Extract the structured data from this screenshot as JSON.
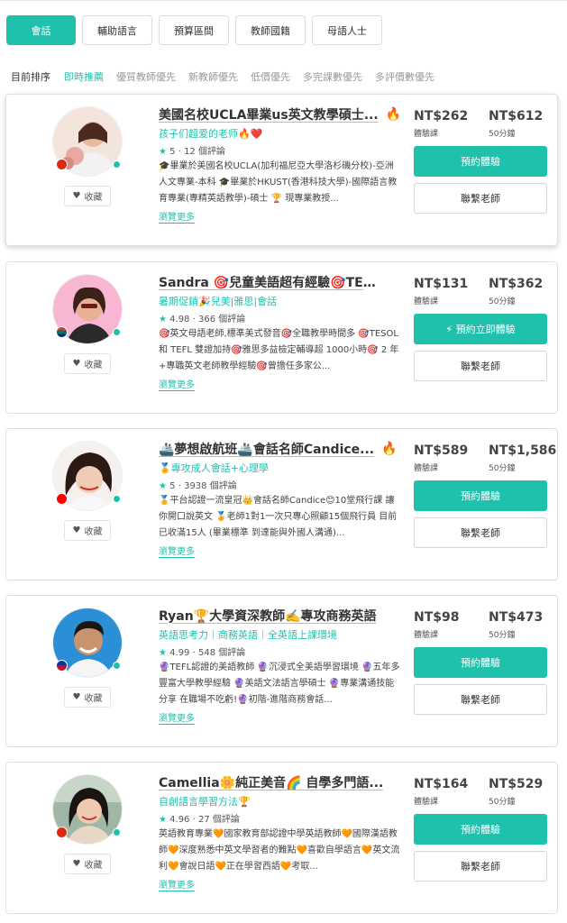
{
  "filters": [
    {
      "label": "會話",
      "active": true
    },
    {
      "label": "輔助語言",
      "active": false
    },
    {
      "label": "預算區間",
      "active": false
    },
    {
      "label": "教師國籍",
      "active": false
    },
    {
      "label": "母語人士",
      "active": false
    }
  ],
  "sort": {
    "label": "目前排序",
    "options": [
      "即時推薦",
      "優質教師優先",
      "新教師優先",
      "低價優先",
      "多完課數優先",
      "多評價數優先"
    ],
    "active_index": 0
  },
  "common": {
    "fav_label": "收藏",
    "trial_unit": "體驗課",
    "regular_unit": "50分鐘",
    "contact_label": "聯繫老師",
    "more_label": "瀏覽更多",
    "star": "★"
  },
  "teachers": [
    {
      "name": "美國名校UCLA畢業us英文教學碩士...",
      "hot": true,
      "tag": "孩子们超爱的老师🔥❤️",
      "rating": "5",
      "reviews": "12 個評論",
      "desc": "🎓畢業於美國名校UCLA(加利福尼亞大學洛杉磯分校)-亞洲人文專業-本科 🎓畢業於HKUST(香港科技大學)-國際語言教育專業(專精英語教學)-碩士 🏆 現專業教授...",
      "trial_price": "NT$262",
      "regular_price": "NT$612",
      "trial_button": "預約體驗",
      "flag": "china"
    },
    {
      "name": "Sandra 🎯兒童美語超有經驗🎯TES...",
      "hot": false,
      "tag": "暑期促銷🎉兒美|雅思|會話",
      "rating": "4.98",
      "reviews": "366 個評論",
      "desc": "🎯英文母語老師,標準美式發音🎯全職教學時間多 🎯TESOL 和 TEFL 雙證加持🎯雅思多益檢定輔導超 1000小時🎯 2 年+專職英文老師教學經驗🎯曾擔任多家公...",
      "trial_price": "NT$131",
      "regular_price": "NT$362",
      "trial_button": "⚡ 預約立即體驗",
      "flag": "south-africa"
    },
    {
      "name": "🚢夢想啟航班🚢會話名師Candice...",
      "hot": true,
      "tag": "🏅專攻成人會話+心理學",
      "rating": "5",
      "reviews": "3938 個評論",
      "desc": "🏅平台認證一流皇冠👑會話名師Candice😊10堂飛行課 讓你開口說英文 🏅老師1對1一次只專心照顧15個飛行員 目前已收滿15人 (畢業標準 到達能與外國人溝通)...",
      "trial_price": "NT$589",
      "regular_price": "NT$1,586",
      "trial_button": "預約體驗",
      "flag": "taiwan"
    },
    {
      "name": "Ryan🏆大學資深教師✍️專攻商務英語",
      "hot": false,
      "tag": "英語思考力｜商務英語｜全英語上課環境",
      "rating": "4.99",
      "reviews": "548 個評論",
      "desc": "🔮TEFL認證的美語教師 🔮沉浸式全美語學習環境 🔮五年多豐富大學教學經驗 🔮美語文法語言學碩士 🔮專業溝通技能分享 在職場不吃虧!🔮初階-進階商務會話...",
      "trial_price": "NT$98",
      "regular_price": "NT$473",
      "trial_button": "預約體驗",
      "flag": "philippines"
    },
    {
      "name": "Camellia🌼純正美音🌈 自學多門語...",
      "hot": false,
      "tag": "自創語言學習方法🏆",
      "rating": "4.96",
      "reviews": "27 個評論",
      "desc": "英語教育專業🧡國家教育部認證中學英語教師🧡國際漢語教師🧡深度熟悉中英文學習者的難點🧡喜歡自學語言🧡英文流利🧡會說日語🧡正在學習西語🧡考取...",
      "trial_price": "NT$164",
      "regular_price": "NT$529",
      "trial_button": "預約體驗",
      "flag": "china"
    }
  ],
  "colors": {
    "accent": "#1fc1ad"
  }
}
